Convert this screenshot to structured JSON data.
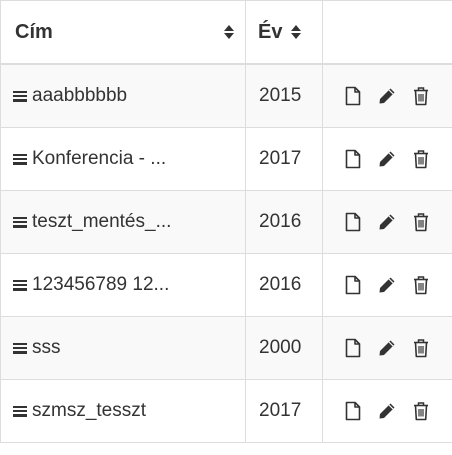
{
  "table": {
    "headers": {
      "title": "Cím",
      "year": "Év"
    },
    "rows": [
      {
        "title": "aaabbbbbb",
        "year": "2015"
      },
      {
        "title": "Konferencia - ...",
        "year": "2017"
      },
      {
        "title": "teszt_mentés_...",
        "year": "2016"
      },
      {
        "title": "123456789 12...",
        "year": "2016"
      },
      {
        "title": "sss",
        "year": "2000"
      },
      {
        "title": "szmsz_tesszt",
        "year": "2017"
      }
    ],
    "row_actions": [
      "view-document-icon",
      "edit-pencil-icon",
      "delete-trash-icon"
    ],
    "row_icon": "drag-handle-icon",
    "sort_icon": "sort-icon"
  }
}
